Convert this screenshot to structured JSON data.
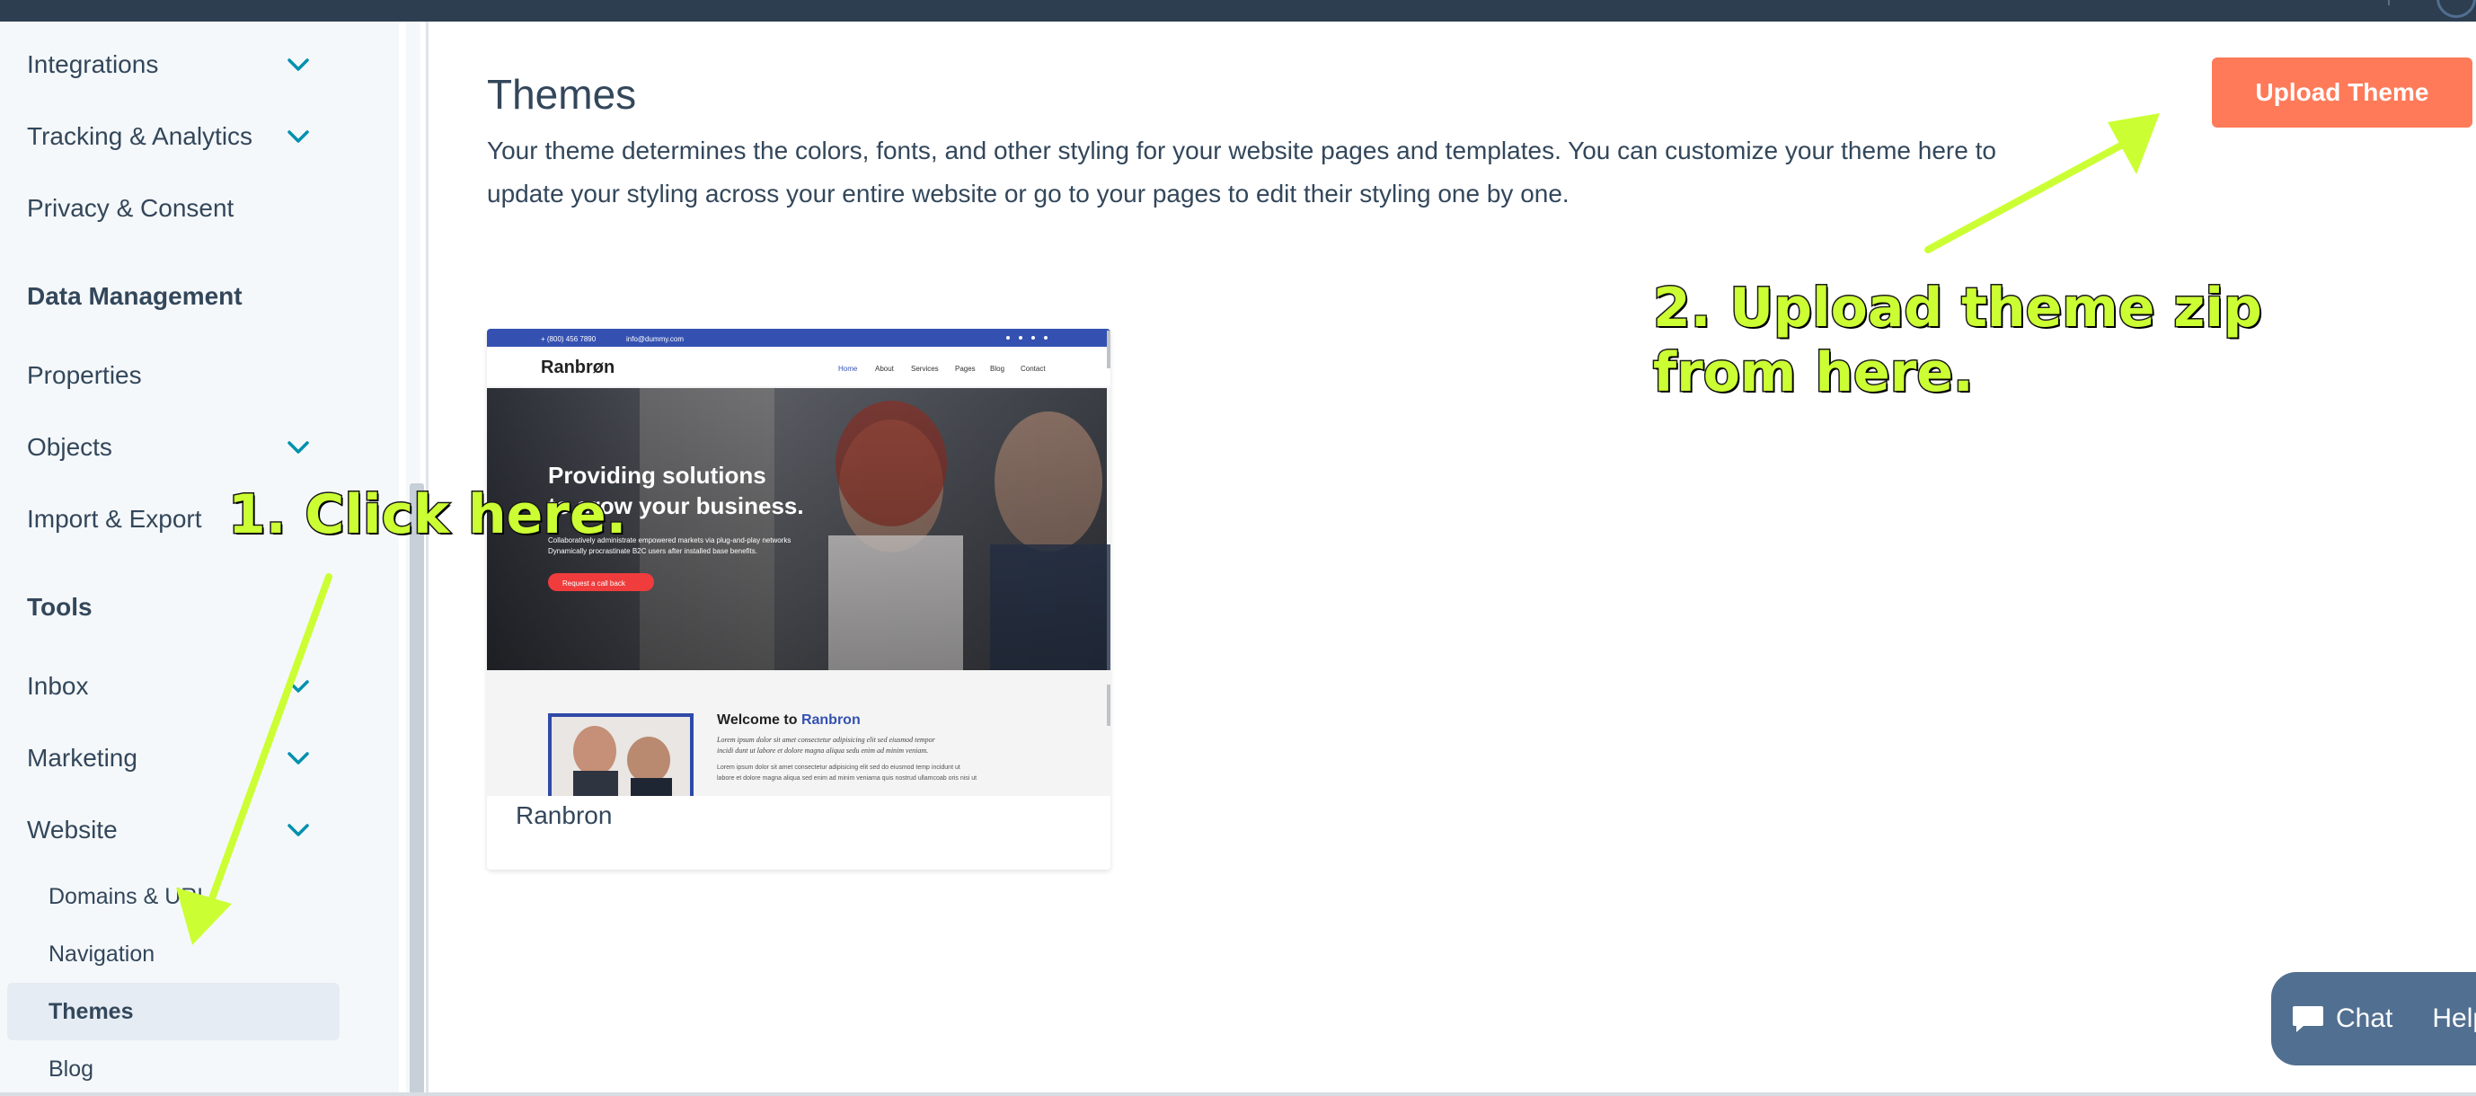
{
  "sidebar": {
    "items": [
      {
        "label": "Integrations",
        "has_chevron": true
      },
      {
        "label": "Tracking & Analytics",
        "has_chevron": true
      },
      {
        "label": "Privacy & Consent",
        "has_chevron": false
      }
    ],
    "data_management_heading": "Data Management",
    "data_items": [
      {
        "label": "Properties",
        "has_chevron": false
      },
      {
        "label": "Objects",
        "has_chevron": true
      },
      {
        "label": "Import & Export",
        "has_chevron": false
      }
    ],
    "tools_heading": "Tools",
    "tool_items": [
      {
        "label": "Inbox",
        "has_chevron": true
      },
      {
        "label": "Marketing",
        "has_chevron": true
      },
      {
        "label": "Website",
        "has_chevron": true
      }
    ],
    "website_subitems": [
      {
        "label": "Domains & URL",
        "active": false
      },
      {
        "label": "Navigation",
        "active": false
      },
      {
        "label": "Themes",
        "active": true
      },
      {
        "label": "Blog",
        "active": false
      }
    ]
  },
  "main": {
    "title": "Themes",
    "description": "Your theme determines the colors, fonts, and other styling for your website pages and templates. You can customize your theme here to update your styling across your entire website or go to your pages to edit their styling one by one.",
    "upload_button": "Upload Theme",
    "theme_card": {
      "name": "Ranbron",
      "preview": {
        "topbar_phone": "+ (800) 456 7890",
        "topbar_email": "info@dummy.com",
        "logo": "Ranbrøn",
        "nav": [
          "Home",
          "About",
          "Services",
          "Pages",
          "Blog",
          "Contact"
        ],
        "hero_heading_line1": "Providing solutions",
        "hero_heading_line2": "to grow your business.",
        "hero_sub_line1": "Collaboratively administrate empowered markets via plug-and-play networks",
        "hero_sub_line2": "Dynamically procrastinate B2C users after installed base benefits.",
        "hero_button": "Request a call back",
        "welcome_prefix": "Welcome to ",
        "welcome_brand": "Ranbron",
        "welcome_italic_line1": "Lorem ipsum dolor sit amet consectetur adipisicing elit sed eiusmod tempor",
        "welcome_italic_line2": "incidi dunt ut labore et dolore magna aliqua sedu enim ad minim veniam.",
        "welcome_body_line1": "Lorem ipsum dolor sit amet consectetur adipisicing elit sed do eiusmod temp incidunt ut",
        "welcome_body_line2": "labore et dolore magna aliqua sed enim ad minim veniama quis nostrud ullamcoab oris nisi ut"
      }
    }
  },
  "annotations": {
    "step1": "1. Click here.",
    "step2_line1": "2. Upload theme zip",
    "step2_line2": "from here."
  },
  "chat": {
    "chat_label": "Chat",
    "help_label": "Help"
  },
  "colors": {
    "accent": "#ff7a59",
    "sidebar_bg": "#f5f8fa",
    "text": "#33475b",
    "chevron": "#0091ae",
    "annotation": "#cbff33",
    "chat_bg": "#516f90"
  }
}
